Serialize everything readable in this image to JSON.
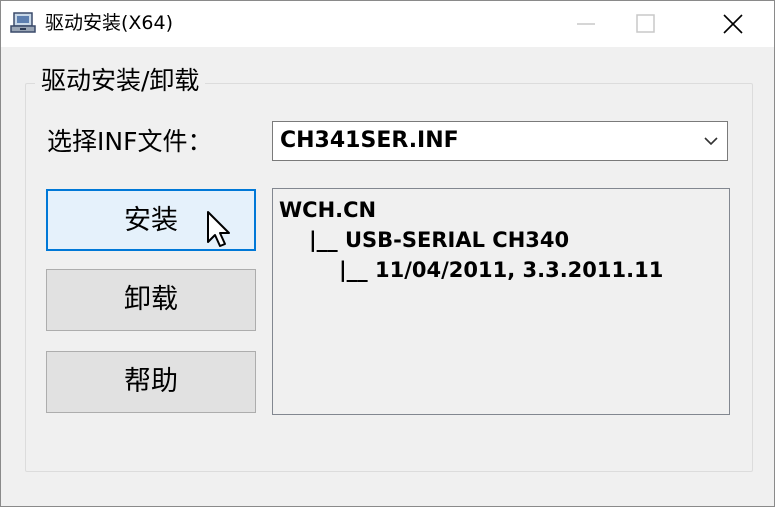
{
  "window": {
    "title": "驱动安装(X64)"
  },
  "titlebar_icons": {
    "app": "driver-setup-icon",
    "minimize": "minimize-icon",
    "maximize": "maximize-icon",
    "close": "close-icon"
  },
  "group": {
    "title": "驱动安装/卸载"
  },
  "inf": {
    "label": "选择INF文件：",
    "selected_value": "CH341SER.INF",
    "arrow_icon": "chevron-down-icon"
  },
  "buttons": {
    "install": "安装",
    "uninstall": "卸载",
    "help": "帮助"
  },
  "info": {
    "lines": [
      "WCH.CN",
      "|__ USB-SERIAL CH340",
      "|__ 11/04/2011, 3.3.2011.11"
    ]
  },
  "colors": {
    "accent": "#0078d7",
    "window_bg": "#f0f0f0",
    "titlebar_bg": "#ffffff"
  }
}
